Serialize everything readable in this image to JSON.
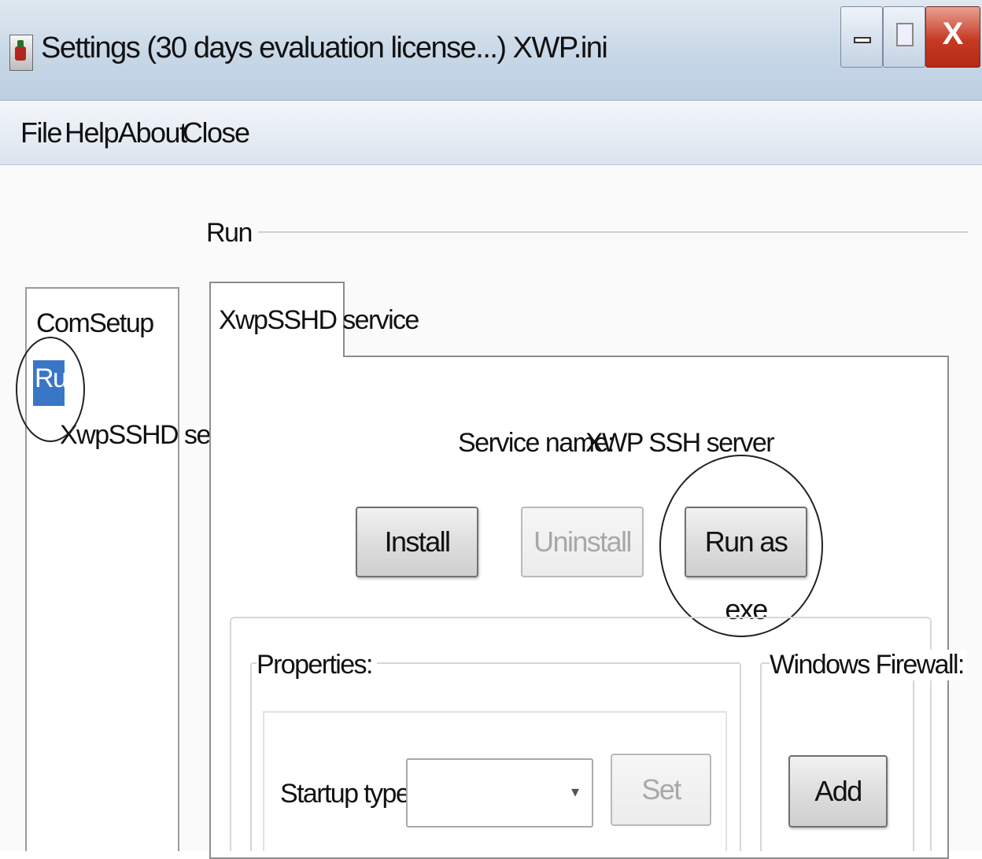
{
  "window": {
    "title": "Settings (30 days evaluation license...) XWP.ini",
    "close_glyph": "X"
  },
  "menu": [
    "File",
    "Help",
    "About",
    "Close"
  ],
  "tree": {
    "items": [
      {
        "label": "ComSetup"
      },
      {
        "label": "Run",
        "selected": true
      },
      {
        "label": "XwpSSHD service"
      }
    ]
  },
  "run_group": {
    "label": "Run"
  },
  "tab": {
    "label": "XwpSSHD service"
  },
  "service": {
    "name_label": "Service name:",
    "name_value": "XWP SSH server"
  },
  "buttons": {
    "install": "Install",
    "uninstall": "Uninstall",
    "run_as_exe": "Run as exe",
    "set": "Set",
    "add": "Add"
  },
  "properties": {
    "label": "Properties:",
    "startup_type_label": "Startup type:",
    "startup_type_value": ""
  },
  "firewall": {
    "label": "Windows Firewall:"
  },
  "colors": {
    "selection": "#3a76c6",
    "titlebar": "#c6d6e6",
    "close_button": "#c63a24"
  }
}
